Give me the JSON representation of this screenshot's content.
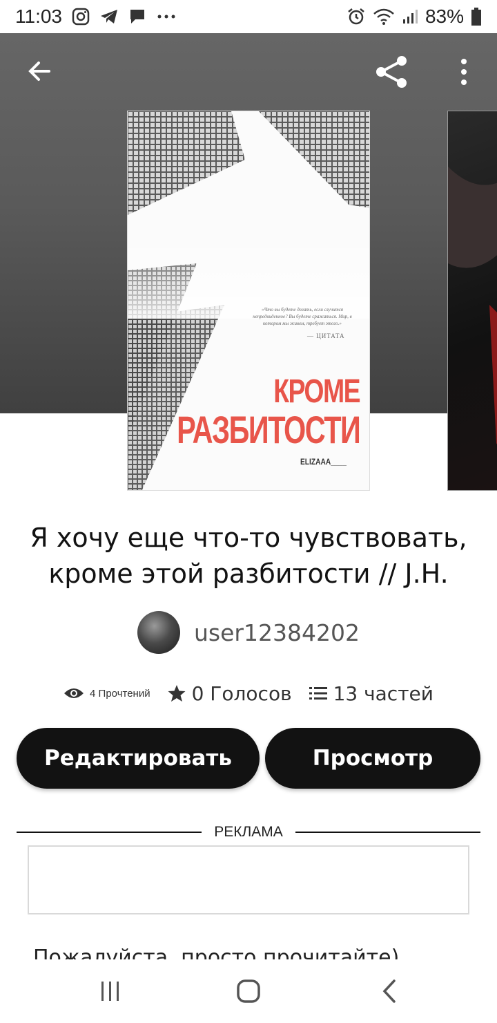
{
  "status_bar": {
    "time": "11:03",
    "battery": "83%",
    "left_icons": [
      "instagram-icon",
      "telegram-icon",
      "message-icon",
      "more-notifications-icon"
    ],
    "right_icons": [
      "alarm-icon",
      "wifi-icon",
      "signal-icon",
      "battery-icon"
    ]
  },
  "toolbar": {
    "back_icon": "arrow-left-icon",
    "share_icon": "share-icon",
    "more_icon": "more-vertical-icon"
  },
  "cover": {
    "quote": "«Что вы будете делать, если случится непредвиденное? Вы будете сражаться. Мир, в котором мы живем, требует этого.»",
    "quote_attribution": "— ЦИТАТА",
    "title_line1": "КРОМЕ",
    "title_line2": "РАЗБИТОСТИ",
    "author": "ELIZAAA____",
    "title_color": "#e8554a"
  },
  "story": {
    "title": "Я хочу еще что-то чувствовать, кроме этой разбитости // J.H.",
    "author": "user12384202"
  },
  "stats": {
    "reads": "4 Прочтений",
    "votes": "0 Голосов",
    "parts": "13 частей"
  },
  "actions": {
    "edit_label": "Редактировать",
    "view_label": "Просмотр"
  },
  "ad": {
    "label": "РЕКЛАМА"
  },
  "description": {
    "text": "Пожалуйста, просто прочитайте)"
  },
  "nav_bar": {
    "icons": [
      "recent-apps-icon",
      "home-icon",
      "back-icon"
    ]
  },
  "colors": {
    "button_bg": "#121212",
    "hero_bg": "#5a5a5a"
  }
}
